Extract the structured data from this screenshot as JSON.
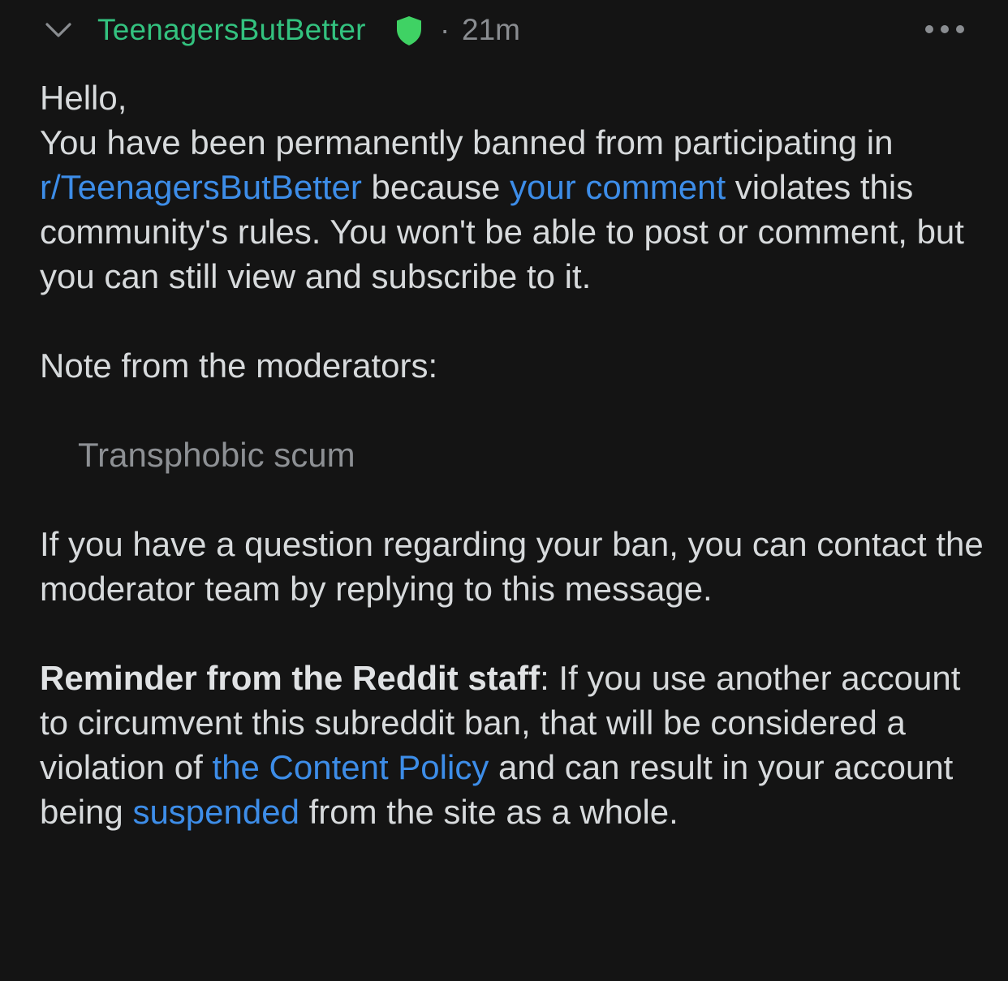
{
  "header": {
    "author": "TeenagersButBetter",
    "separator": "·",
    "timestamp": "21m",
    "icons": {
      "collapse": "chevron-down-icon",
      "mod_badge": "shield-icon",
      "more": "more-horizontal-icon"
    },
    "colors": {
      "author": "#33c27f",
      "shield": "#3fd264",
      "meta": "#8a8d91"
    }
  },
  "message": {
    "greeting": "Hello,",
    "ban_notice": {
      "part1": "You have been permanently banned from participating in ",
      "subreddit_link": "r/TeenagersButBetter",
      "part2": " because ",
      "comment_link": "your comment",
      "part3": " violates this community's rules. You won't be able to post or comment, but you can still view and subscribe to it."
    },
    "note_heading": "Note from the moderators:",
    "mod_note": "Transphobic scum",
    "contact_text": "If you have a question regarding your ban, you can contact the moderator team by replying to this message.",
    "reminder": {
      "bold": "Reminder from the Reddit staff",
      "part1": ": If you use another account to circumvent this subreddit ban, that will be considered a violation of ",
      "policy_link": "the Content Policy",
      "part2": " and can result in your account being ",
      "suspended_link": "suspended",
      "part3": " from the site as a whole."
    },
    "colors": {
      "text": "#d7dadc",
      "link": "#3d8de8",
      "quote": "#8d9094",
      "background": "#141414"
    }
  }
}
